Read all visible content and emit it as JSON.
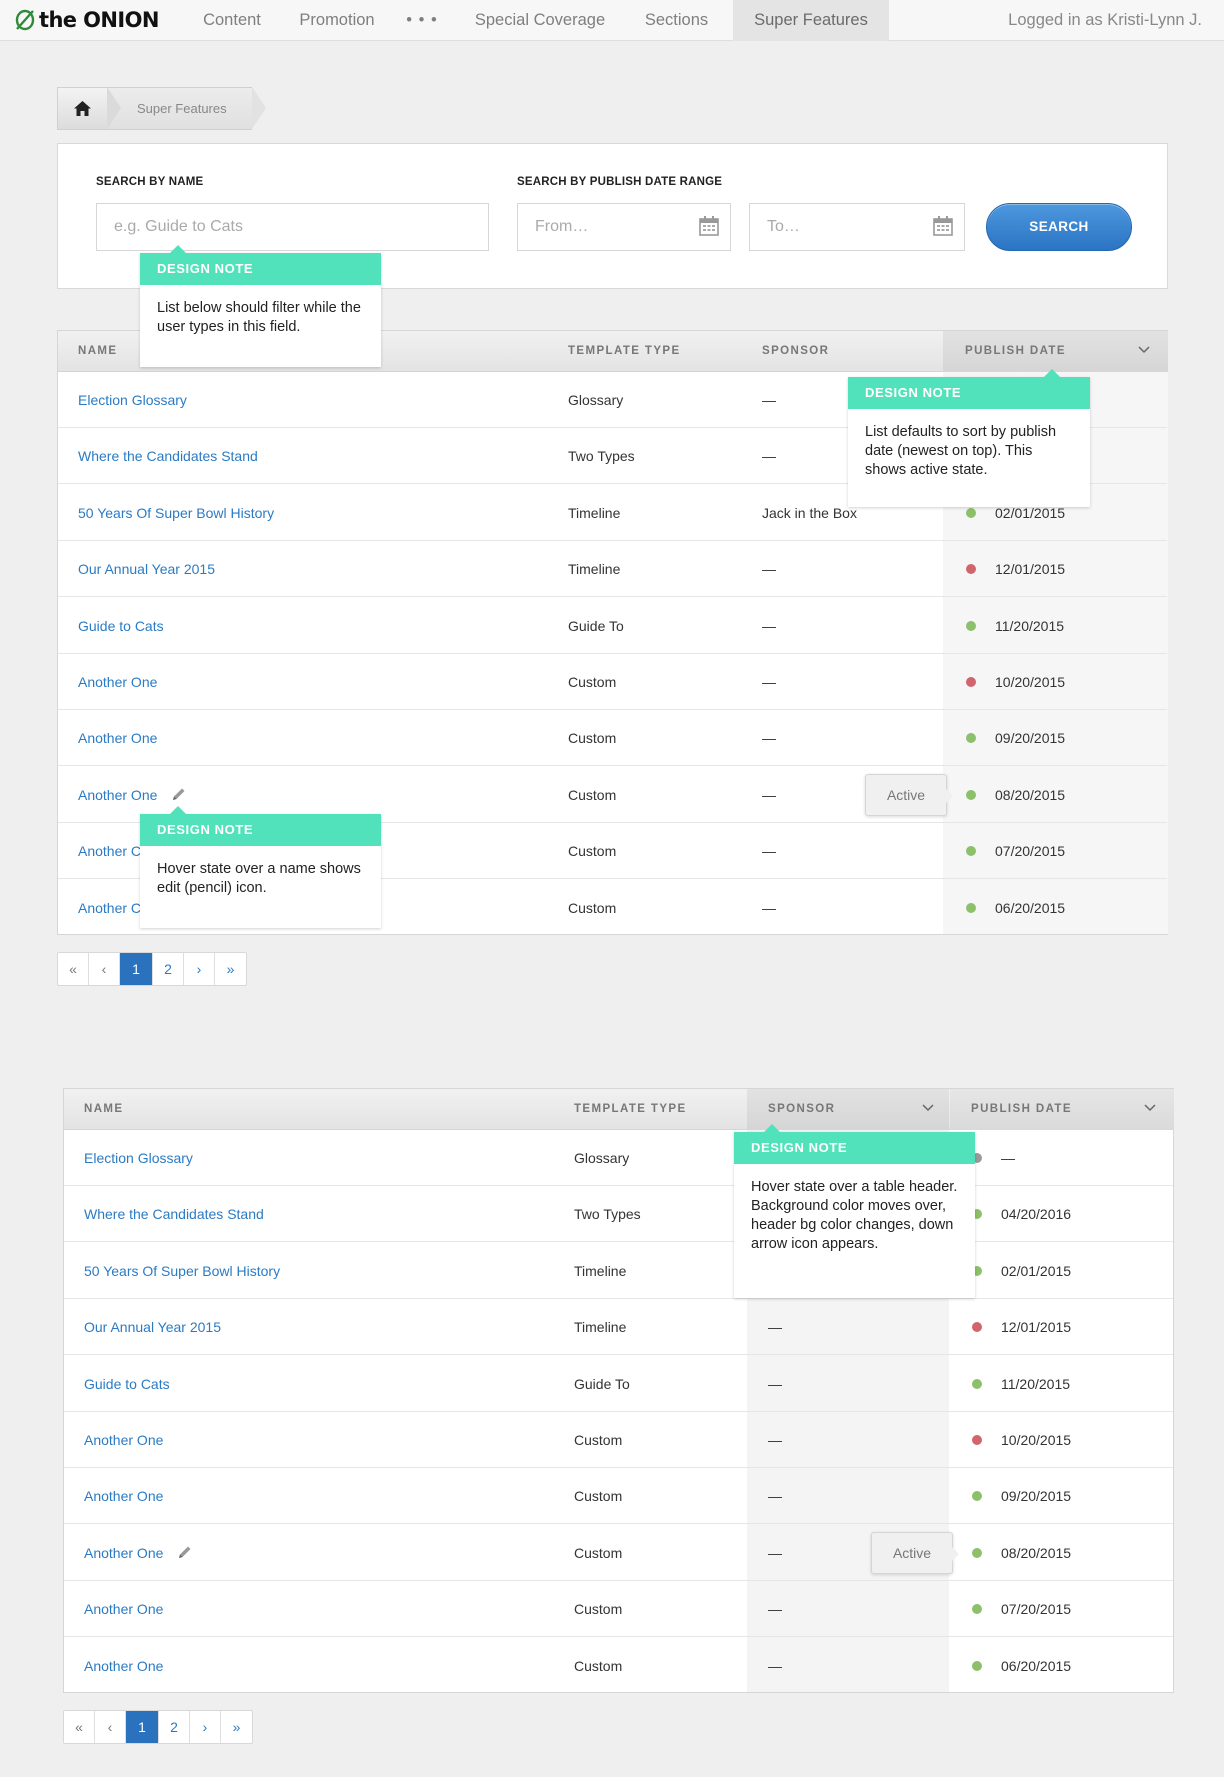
{
  "nav": {
    "logo": "the ONION",
    "items": [
      "Content",
      "Promotion",
      "• • •",
      "Special Coverage",
      "Sections",
      "Super Features"
    ],
    "active": "Super Features",
    "user": "Logged in as Kristi-Lynn J."
  },
  "breadcrumb": {
    "label": "Super Features"
  },
  "search": {
    "name_label": "SEARCH BY NAME",
    "name_placeholder": "e.g. Guide to Cats",
    "date_label": "SEARCH BY PUBLISH DATE RANGE",
    "from_placeholder": "From…",
    "to_placeholder": "To…",
    "button": "SEARCH"
  },
  "headers": {
    "name": "NAME",
    "template": "TEMPLATE TYPE",
    "sponsor": "SPONSOR",
    "date": "PUBLISH DATE"
  },
  "status_colors": {
    "green": "#8dc06a",
    "red": "#d0656e",
    "grey": "#999999"
  },
  "table1": [
    {
      "name": "Election Glossary",
      "template": "Glossary",
      "sponsor": "—",
      "date": "",
      "status": ""
    },
    {
      "name": "Where the Candidates Stand",
      "template": "Two Types",
      "sponsor": "—",
      "date": "",
      "status": ""
    },
    {
      "name": "50 Years Of Super Bowl History",
      "template": "Timeline",
      "sponsor": "Jack in the Box",
      "date": "02/01/2015",
      "status": "green"
    },
    {
      "name": "Our Annual Year 2015",
      "template": "Timeline",
      "sponsor": "—",
      "date": "12/01/2015",
      "status": "red"
    },
    {
      "name": "Guide to Cats",
      "template": "Guide To",
      "sponsor": "—",
      "date": "11/20/2015",
      "status": "green"
    },
    {
      "name": "Another One",
      "template": "Custom",
      "sponsor": "—",
      "date": "10/20/2015",
      "status": "red"
    },
    {
      "name": "Another One",
      "template": "Custom",
      "sponsor": "—",
      "date": "09/20/2015",
      "status": "green"
    },
    {
      "name": "Another One",
      "template": "Custom",
      "sponsor": "—",
      "date": "08/20/2015",
      "status": "green",
      "pencil": true,
      "tip": "Active"
    },
    {
      "name": "Another C",
      "template": "Custom",
      "sponsor": "—",
      "date": "07/20/2015",
      "status": "green"
    },
    {
      "name": "Another C",
      "template": "Custom",
      "sponsor": "—",
      "date": "06/20/2015",
      "status": "green"
    }
  ],
  "table2": [
    {
      "name": "Election Glossary",
      "template": "Glossary",
      "sponsor": "",
      "date": "—",
      "status": "grey"
    },
    {
      "name": "Where the Candidates Stand",
      "template": "Two Types",
      "sponsor": "",
      "date": "04/20/2016",
      "status": "green"
    },
    {
      "name": "50 Years Of Super Bowl History",
      "template": "Timeline",
      "sponsor": "",
      "date": "02/01/2015",
      "status": "green"
    },
    {
      "name": "Our Annual Year 2015",
      "template": "Timeline",
      "sponsor": "—",
      "date": "12/01/2015",
      "status": "red"
    },
    {
      "name": "Guide to Cats",
      "template": "Guide To",
      "sponsor": "—",
      "date": "11/20/2015",
      "status": "green"
    },
    {
      "name": "Another One",
      "template": "Custom",
      "sponsor": "—",
      "date": "10/20/2015",
      "status": "red"
    },
    {
      "name": "Another One",
      "template": "Custom",
      "sponsor": "—",
      "date": "09/20/2015",
      "status": "green"
    },
    {
      "name": "Another One",
      "template": "Custom",
      "sponsor": "—",
      "date": "08/20/2015",
      "status": "green",
      "pencil": true,
      "tip": "Active"
    },
    {
      "name": "Another One",
      "template": "Custom",
      "sponsor": "—",
      "date": "07/20/2015",
      "status": "green"
    },
    {
      "name": "Another One",
      "template": "Custom",
      "sponsor": "—",
      "date": "06/20/2015",
      "status": "green"
    }
  ],
  "pager": {
    "first": "«",
    "prev": "‹",
    "pages": [
      "1",
      "2"
    ],
    "current": "1",
    "next": "›",
    "last": "»"
  },
  "notes": {
    "title": "DESIGN NOTE",
    "filter": "List below should filter while the user types in this field.",
    "sort": "List defaults to sort by publish date (newest on top). This shows active state.",
    "hover_name": "Hover state over a name shows edit (pencil) icon.",
    "hover_header": "Hover state over a table header. Background color moves over, header bg color changes, down arrow icon appears."
  }
}
